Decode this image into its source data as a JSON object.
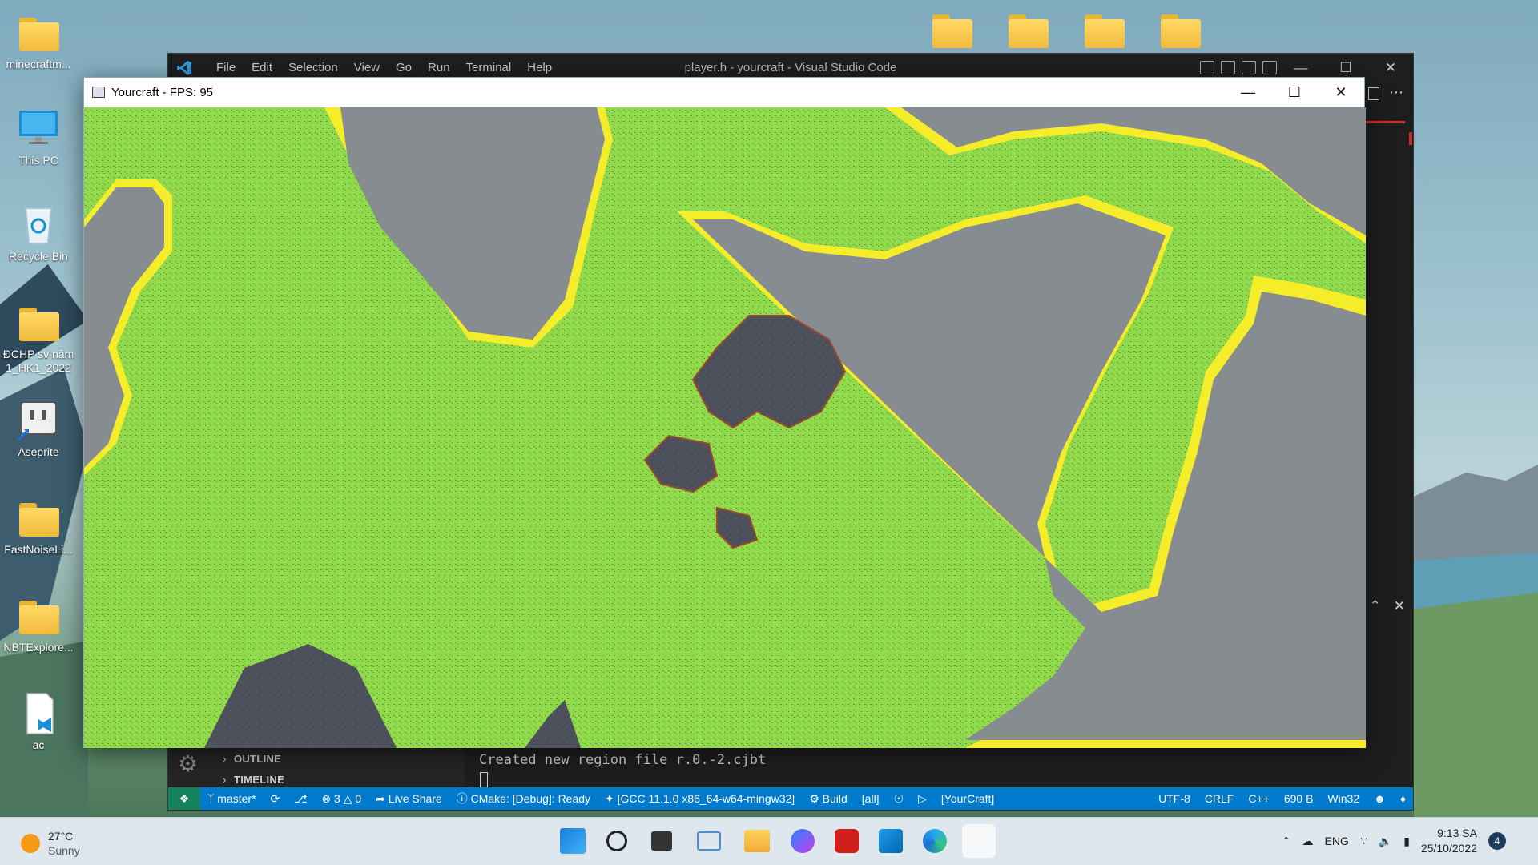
{
  "desktop": {
    "icons": [
      {
        "label": "minecraftm..."
      },
      {
        "label": "This PC"
      },
      {
        "label": "Recycle Bin"
      },
      {
        "label": "ĐCHP sv năm 1_HK1_2022"
      },
      {
        "label": "Aseprite"
      },
      {
        "label": "FastNoiseLi..."
      },
      {
        "label": "NBTExplore..."
      },
      {
        "label": "ac"
      }
    ]
  },
  "vscode": {
    "menu": [
      "File",
      "Edit",
      "Selection",
      "View",
      "Go",
      "Run",
      "Terminal",
      "Help"
    ],
    "title": "player.h - yourcraft - Visual Studio Code",
    "outline_label": "OUTLINE",
    "timeline_label": "TIMELINE",
    "terminal_line": "Created new region file r.0.-2.cjbt",
    "status": {
      "branch": "master*",
      "errors": "3",
      "warnings": "0",
      "live_share": "Live Share",
      "cmake": "CMake: [Debug]: Ready",
      "kit": "[GCC 11.1.0 x86_64-w64-mingw32]",
      "build": "Build",
      "target_all": "[all]",
      "launch_target": "[YourCraft]",
      "encoding": "UTF-8",
      "eol": "CRLF",
      "language": "C++",
      "size": "690 B",
      "platform": "Win32"
    }
  },
  "game": {
    "title": "Yourcraft - FPS: 95"
  },
  "taskbar": {
    "weather_temp": "27°C",
    "weather_desc": "Sunny",
    "lang": "ENG",
    "time": "9:13 SA",
    "date": "25/10/2022",
    "notifications": "4"
  }
}
